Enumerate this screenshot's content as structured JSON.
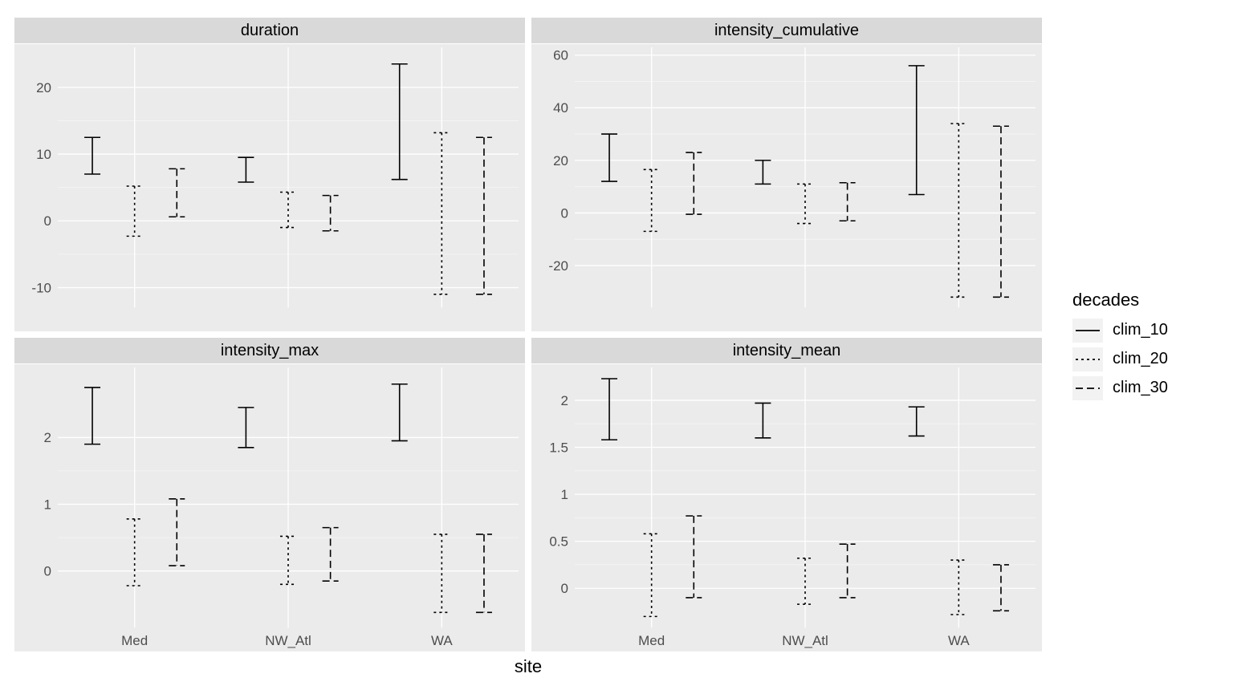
{
  "xlabel": "site",
  "legend": {
    "title": "decades",
    "items": [
      {
        "name": "clim_10",
        "dash": null
      },
      {
        "name": "clim_20",
        "dash": "3,4"
      },
      {
        "name": "clim_30",
        "dash": "9,5"
      }
    ]
  },
  "chart_data": [
    {
      "facet": "duration",
      "type": "errorbar",
      "ylabel": "",
      "ylim": [
        -13,
        26
      ],
      "yticks": [
        -10,
        0,
        10,
        20
      ],
      "categories": [
        "Med",
        "NW_Atl",
        "WA"
      ],
      "series": [
        {
          "name": "clim_10",
          "dash": null,
          "values": [
            {
              "lo": 7.0,
              "hi": 12.5
            },
            {
              "lo": 5.8,
              "hi": 9.5
            },
            {
              "lo": 6.2,
              "hi": 23.5
            }
          ]
        },
        {
          "name": "clim_20",
          "dash": "3,4",
          "values": [
            {
              "lo": -2.3,
              "hi": 5.2
            },
            {
              "lo": -1.0,
              "hi": 4.3
            },
            {
              "lo": -11.0,
              "hi": 13.2
            }
          ]
        },
        {
          "name": "clim_30",
          "dash": "9,5",
          "values": [
            {
              "lo": 0.6,
              "hi": 7.8
            },
            {
              "lo": -1.5,
              "hi": 3.8
            },
            {
              "lo": -11.0,
              "hi": 12.5
            }
          ]
        }
      ]
    },
    {
      "facet": "intensity_cumulative",
      "type": "errorbar",
      "ylabel": "",
      "ylim": [
        -36,
        63
      ],
      "yticks": [
        -20,
        0,
        20,
        40,
        60
      ],
      "categories": [
        "Med",
        "NW_Atl",
        "WA"
      ],
      "series": [
        {
          "name": "clim_10",
          "dash": null,
          "values": [
            {
              "lo": 12.0,
              "hi": 30.0
            },
            {
              "lo": 11.0,
              "hi": 20.0
            },
            {
              "lo": 7.0,
              "hi": 56.0
            }
          ]
        },
        {
          "name": "clim_20",
          "dash": "3,4",
          "values": [
            {
              "lo": -7.0,
              "hi": 16.5
            },
            {
              "lo": -4.0,
              "hi": 11.0
            },
            {
              "lo": -32.0,
              "hi": 34.0
            }
          ]
        },
        {
          "name": "clim_30",
          "dash": "9,5",
          "values": [
            {
              "lo": -0.5,
              "hi": 23.0
            },
            {
              "lo": -3.0,
              "hi": 11.5
            },
            {
              "lo": -32.0,
              "hi": 33.0
            }
          ]
        }
      ]
    },
    {
      "facet": "intensity_max",
      "type": "errorbar",
      "ylabel": "",
      "ylim": [
        -0.85,
        3.05
      ],
      "yticks": [
        0,
        1,
        2
      ],
      "categories": [
        "Med",
        "NW_Atl",
        "WA"
      ],
      "series": [
        {
          "name": "clim_10",
          "dash": null,
          "values": [
            {
              "lo": 1.9,
              "hi": 2.75
            },
            {
              "lo": 1.85,
              "hi": 2.45
            },
            {
              "lo": 1.95,
              "hi": 2.8
            }
          ]
        },
        {
          "name": "clim_20",
          "dash": "3,4",
          "values": [
            {
              "lo": -0.22,
              "hi": 0.78
            },
            {
              "lo": -0.2,
              "hi": 0.52
            },
            {
              "lo": -0.62,
              "hi": 0.55
            }
          ]
        },
        {
          "name": "clim_30",
          "dash": "9,5",
          "values": [
            {
              "lo": 0.08,
              "hi": 1.08
            },
            {
              "lo": -0.15,
              "hi": 0.65
            },
            {
              "lo": -0.62,
              "hi": 0.55
            }
          ]
        }
      ]
    },
    {
      "facet": "intensity_mean",
      "type": "errorbar",
      "ylabel": "",
      "ylim": [
        -0.42,
        2.35
      ],
      "yticks": [
        0.0,
        0.5,
        1.0,
        1.5,
        2.0
      ],
      "categories": [
        "Med",
        "NW_Atl",
        "WA"
      ],
      "series": [
        {
          "name": "clim_10",
          "dash": null,
          "values": [
            {
              "lo": 1.58,
              "hi": 2.23
            },
            {
              "lo": 1.6,
              "hi": 1.97
            },
            {
              "lo": 1.62,
              "hi": 1.93
            }
          ]
        },
        {
          "name": "clim_20",
          "dash": "3,4",
          "values": [
            {
              "lo": -0.3,
              "hi": 0.58
            },
            {
              "lo": -0.17,
              "hi": 0.32
            },
            {
              "lo": -0.28,
              "hi": 0.3
            }
          ]
        },
        {
          "name": "clim_30",
          "dash": "9,5",
          "values": [
            {
              "lo": -0.1,
              "hi": 0.77
            },
            {
              "lo": -0.1,
              "hi": 0.47
            },
            {
              "lo": -0.24,
              "hi": 0.25
            }
          ]
        }
      ]
    }
  ]
}
